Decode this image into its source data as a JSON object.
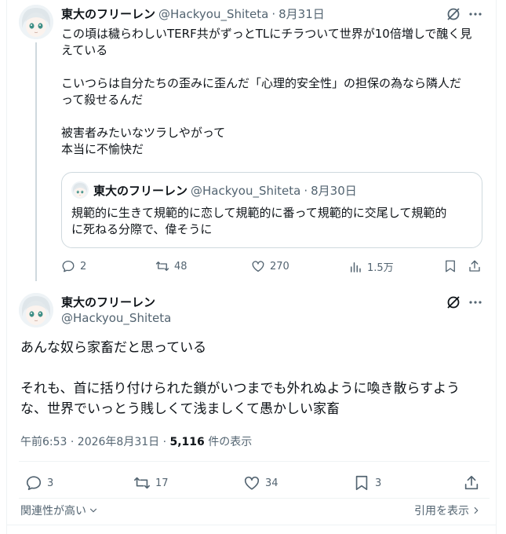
{
  "post1": {
    "display_name": "東大のフリーレン",
    "handle": "@Hackyou_Shiteta",
    "separator": "·",
    "date": "8月31日",
    "text": "この頃は穢らわしいTERF共がずっとTLにチラついて世界が10倍増しで醜く見\nえている\n\nこいつらは自分たちの歪みに歪んだ「心理的安全性」の担保の為なら隣人だ\nって殺せるんだ\n\n被害者みたいなツラしやがって\n本当に不愉快だ",
    "quote": {
      "display_name": "東大のフリーレン",
      "handle": "@Hackyou_Shiteta",
      "separator": "·",
      "date": "8月30日",
      "text": "規範的に生きて規範的に恋して規範的に番って規範的に交尾して規範的\nに死ねる分際で、偉そうに"
    },
    "stats": {
      "replies": "2",
      "reposts": "48",
      "likes": "270",
      "views": "1.5万"
    }
  },
  "post2": {
    "display_name": "東大のフリーレン",
    "handle": "@Hackyou_Shiteta",
    "text": "あんな奴ら家畜だと思っている\n\nそれも、首に括り付けられた鎖がいつまでも外れぬように喚き散らすよう\nな、世界でいっとう賎しくて浅ましくて愚かしい家畜",
    "time_date": "午前6:53 · 2026年8月31日 · ",
    "view_count": "5,116",
    "view_label": " 件の表示",
    "stats": {
      "replies": "3",
      "reposts": "17",
      "likes": "34",
      "bookmarks": "3"
    }
  },
  "footer": {
    "sort_label": "関連性が高い",
    "quotes_label": "引用を表示"
  },
  "colors": {
    "text": "#0f1419",
    "muted": "#536471",
    "border": "#cfd9de",
    "divider": "#eff3f4"
  }
}
